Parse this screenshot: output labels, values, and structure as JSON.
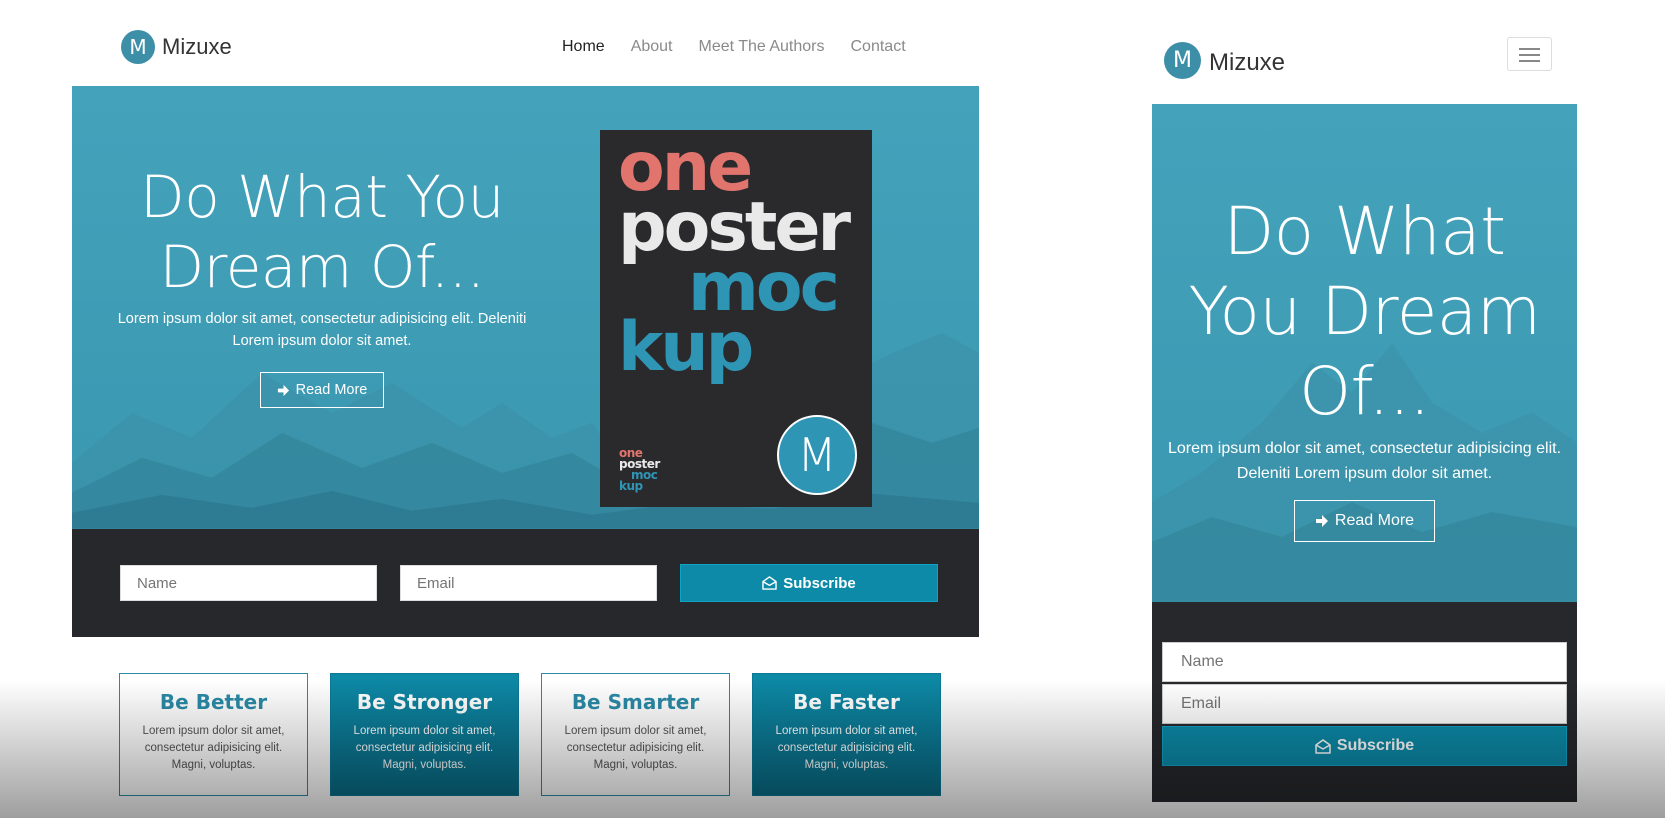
{
  "desktop": {
    "brand": {
      "logo_letter": "M",
      "name": "Mizuxe"
    },
    "nav": [
      {
        "label": "Home",
        "active": true
      },
      {
        "label": "About"
      },
      {
        "label": "Meet The Authors"
      },
      {
        "label": "Contact"
      }
    ],
    "hero": {
      "headline_line1": "Do What You",
      "headline_line2": "Dream Of...",
      "subtext_line1": "Lorem ipsum dolor sit amet, consectetur adipisicing elit. Deleniti",
      "subtext_line2": "Lorem ipsum dolor sit amet.",
      "button_label": "Read More",
      "button_icon": "arrow-right-icon"
    },
    "poster": {
      "word1": "one",
      "word2": "poster",
      "word3": "moc",
      "word4": "kup",
      "badge_letter": "M",
      "colors": {
        "one": "#e2746e",
        "poster": "#e9e9e9",
        "mockup": "#2f95b5"
      }
    },
    "subscribe": {
      "name_placeholder": "Name",
      "email_placeholder": "Email",
      "button_label": "Subscribe",
      "button_icon": "envelope-open-icon"
    },
    "cards": [
      {
        "title": "Be Better",
        "text": "Lorem ipsum dolor sit amet, consectetur adipisicing elit. Magni, voluptas.",
        "style": "outline"
      },
      {
        "title": "Be Stronger",
        "text": "Lorem ipsum dolor sit amet, consectetur adipisicing elit. Magni, voluptas.",
        "style": "filled"
      },
      {
        "title": "Be Smarter",
        "text": "Lorem ipsum dolor sit amet, consectetur adipisicing elit. Magni, voluptas.",
        "style": "outline"
      },
      {
        "title": "Be Faster",
        "text": "Lorem ipsum dolor sit amet, consectetur adipisicing elit. Magni, voluptas.",
        "style": "filled"
      }
    ]
  },
  "mobile": {
    "brand": {
      "logo_letter": "M",
      "name": "Mizuxe"
    },
    "menu_icon": "hamburger-icon",
    "hero": {
      "headline": "Do What You Dream Of...",
      "subtext": "Lorem ipsum dolor sit amet, consectetur adipisicing elit. Deleniti Lorem ipsum dolor sit amet.",
      "button_label": "Read More",
      "button_icon": "arrow-right-icon"
    },
    "subscribe": {
      "name_placeholder": "Name",
      "email_placeholder": "Email",
      "button_label": "Subscribe",
      "button_icon": "envelope-open-icon"
    }
  },
  "colors": {
    "accent": "#0c8aa8",
    "hero_bg": "#44a2bb",
    "dark_band": "#27282c",
    "logo_bg": "#3d8fa8"
  }
}
